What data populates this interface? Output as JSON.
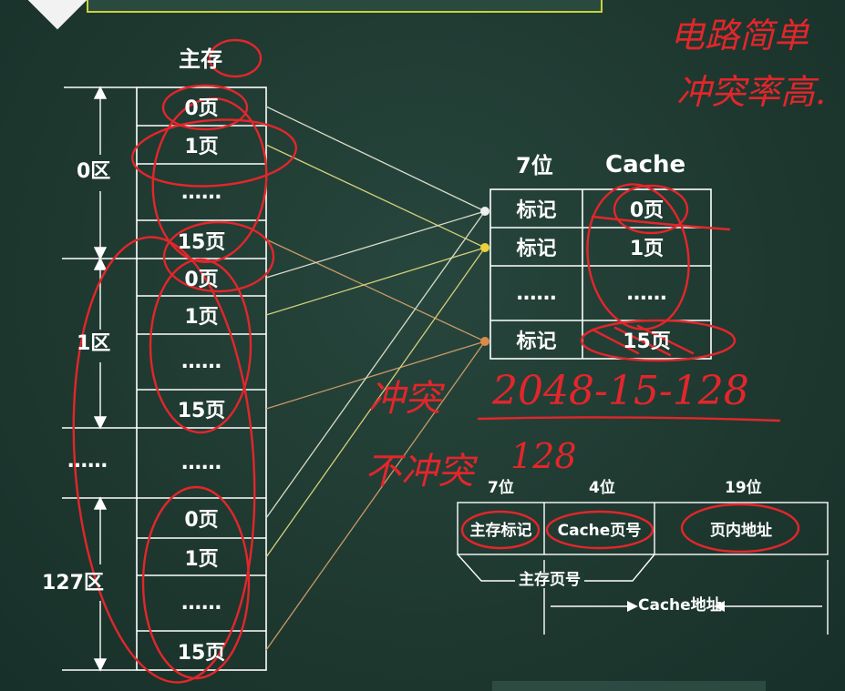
{
  "main_memory": {
    "title": "主存",
    "zones": [
      {
        "label": "0区",
        "pages": [
          "0页",
          "1页",
          "……",
          "15页"
        ]
      },
      {
        "label": "1区",
        "pages": [
          "0页",
          "1页",
          "……",
          "15页"
        ]
      },
      {
        "label": "……",
        "pages": [
          "……"
        ]
      },
      {
        "label": "127区",
        "pages": [
          "0页",
          "1页",
          "……",
          "15页"
        ]
      }
    ]
  },
  "cache": {
    "title": "Cache",
    "tag_bits": "7位",
    "rows": [
      {
        "tag": "标记",
        "page": "0页"
      },
      {
        "tag": "标记",
        "page": "1页"
      },
      {
        "tag": "……",
        "page": "……"
      },
      {
        "tag": "标记",
        "page": "15页"
      }
    ]
  },
  "address_format": {
    "fields": [
      {
        "bits": "7位",
        "label": "主存标记"
      },
      {
        "bits": "4位",
        "label": "Cache页号"
      },
      {
        "bits": "19位",
        "label": "页内地址"
      }
    ],
    "main_page_label": "主存页号",
    "cache_addr_label": "Cache地址"
  },
  "annotations": {
    "top_right_1": "电路简单",
    "top_right_2": "冲突率高.",
    "conflict_label": "冲突",
    "conflict_value": "2048-15-128",
    "no_conflict_label": "不冲突",
    "no_conflict_value": "128"
  },
  "colors": {
    "ink": "#e3262b",
    "chalk": "#ffffff",
    "board": "#1f3a32"
  }
}
